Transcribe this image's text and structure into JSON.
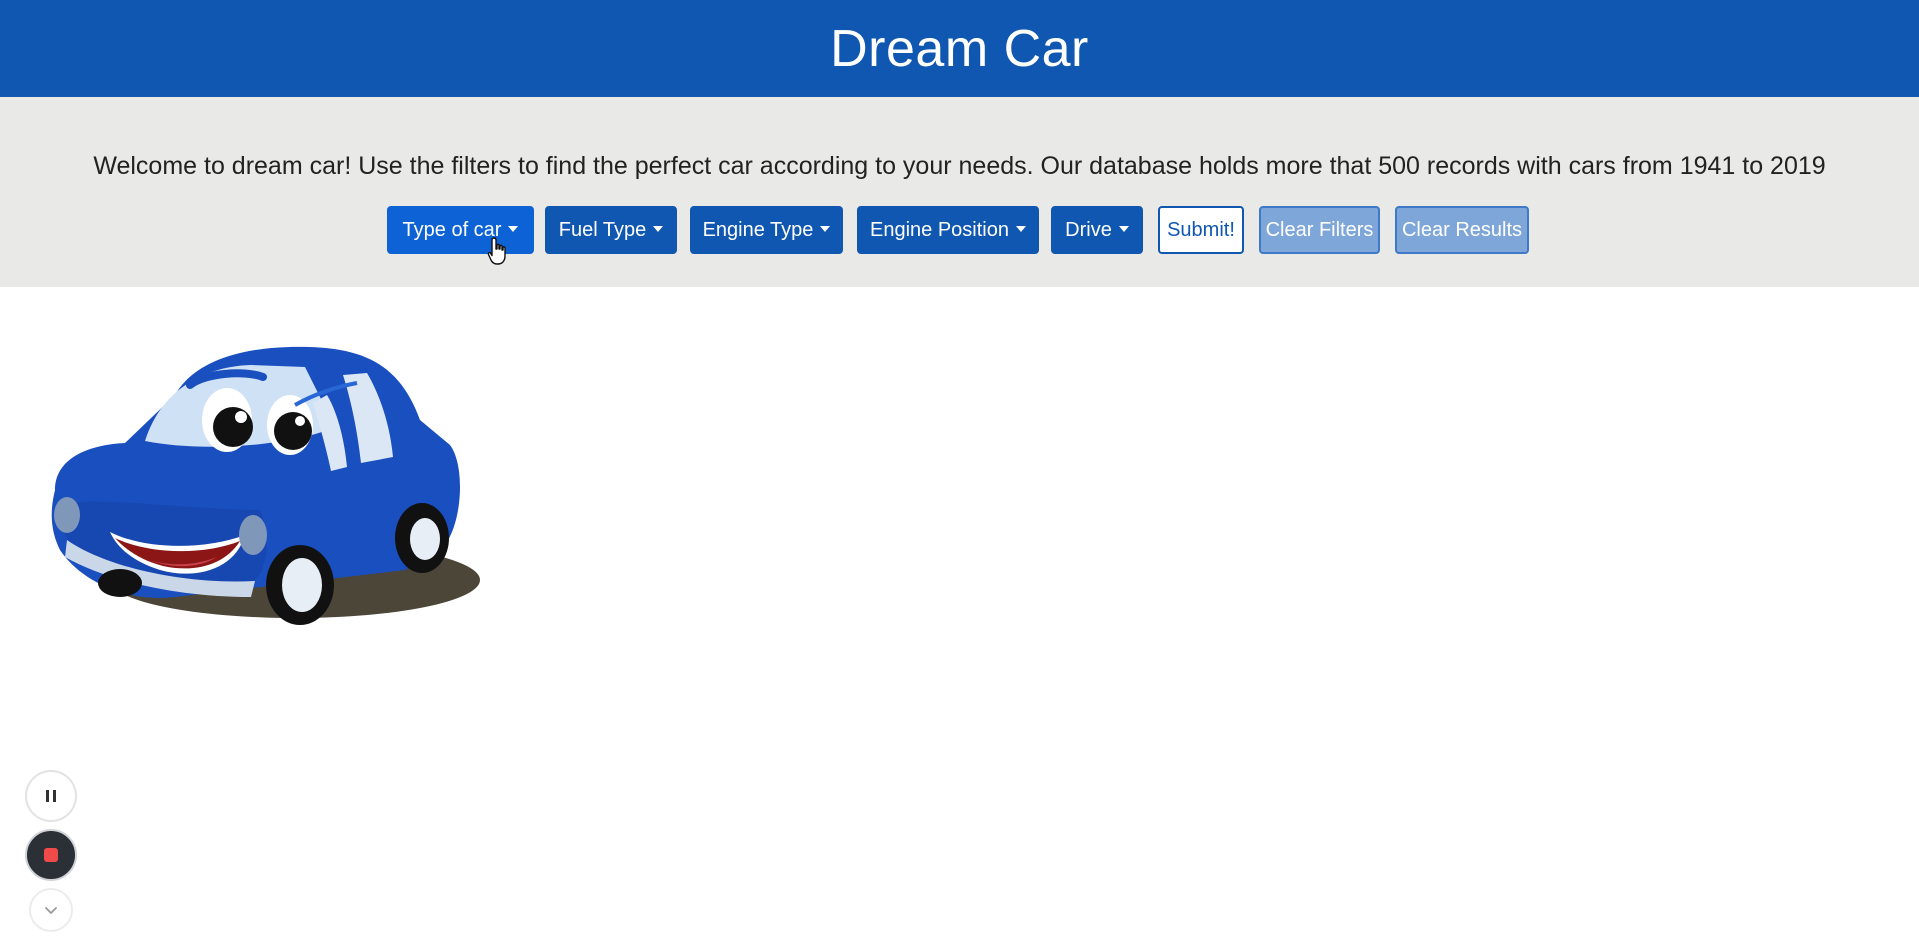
{
  "header": {
    "title": "Dream Car"
  },
  "intro": {
    "text": "Welcome to dream car! Use the filters to find the perfect car according to your needs. Our database holds more that 500 records with cars from 1941 to 2019"
  },
  "filters": {
    "type_of_car": "Type of car",
    "fuel_type": "Fuel Type",
    "engine_type": "Engine Type",
    "engine_position": "Engine Position",
    "drive": "Drive"
  },
  "actions": {
    "submit": "Submit!",
    "clear_filters": "Clear Filters",
    "clear_results": "Clear Results"
  },
  "recorder": {
    "pause_icon": "pause-icon",
    "stop_icon": "stop-icon",
    "more_icon": "chevron-down-icon"
  },
  "colors": {
    "brand": "#0f57b1",
    "active_button": "#0d63d6",
    "muted_button": "#7ea6d8",
    "jumbotron": "#e9e9e8"
  }
}
